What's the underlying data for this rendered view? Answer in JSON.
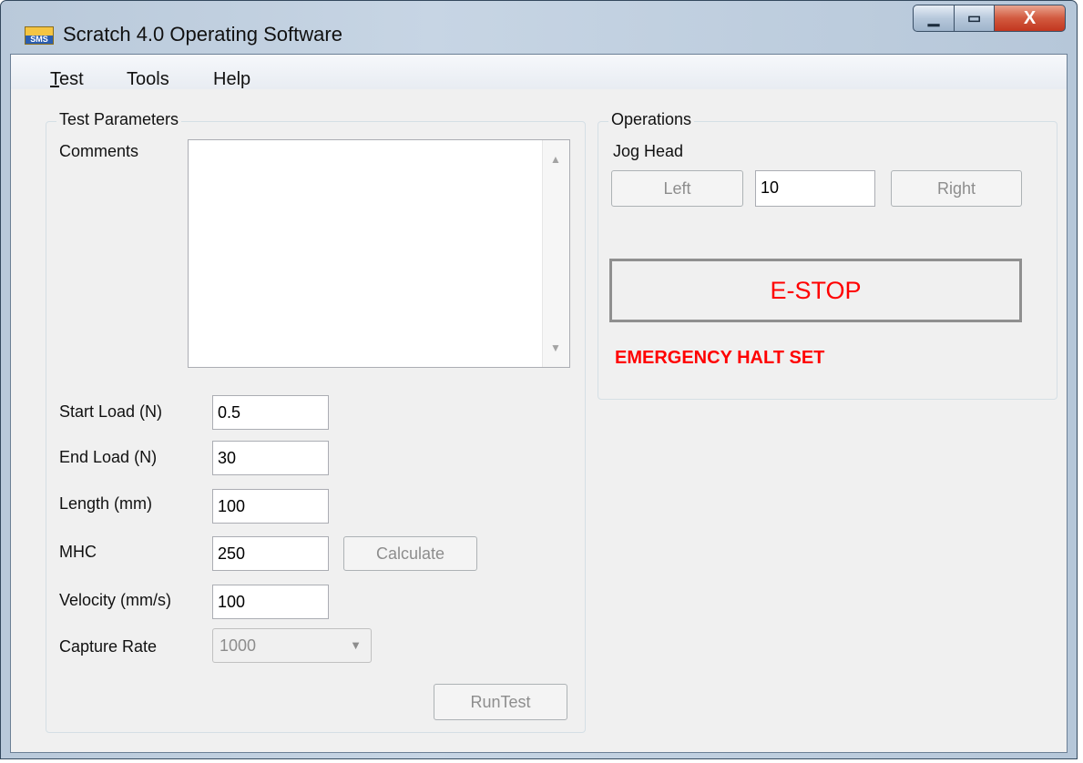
{
  "window": {
    "title": "Scratch 4.0 Operating Software",
    "app_icon_text": "SMS",
    "controls": {
      "minimize": "▁",
      "maximize": "▭",
      "close": "X"
    }
  },
  "menu": [
    {
      "hotkey": "T",
      "rest": "est"
    },
    {
      "hotkey": "",
      "rest": "Tools"
    },
    {
      "hotkey": "",
      "rest": "Help"
    }
  ],
  "test_params": {
    "group_label": "Test Parameters",
    "comments_label": "Comments",
    "comments_value": "",
    "start_load": {
      "label": "Start Load (N)",
      "value": "0.5"
    },
    "end_load": {
      "label": "End Load (N)",
      "value": "30"
    },
    "length": {
      "label": "Length (mm)",
      "value": "100"
    },
    "mhc": {
      "label": "MHC",
      "value": "250"
    },
    "calculate_label": "Calculate",
    "velocity": {
      "label": "Velocity (mm/s)",
      "value": "100"
    },
    "capture_rate": {
      "label": "Capture Rate",
      "value": "1000"
    },
    "run_label": "RunTest"
  },
  "operations": {
    "group_label": "Operations",
    "jog_label": "Jog Head",
    "left_label": "Left",
    "jog_value": "10",
    "right_label": "Right",
    "estop_label": "E-STOP",
    "halt_status": "EMERGENCY HALT SET"
  },
  "colors": {
    "estop_text": "#ff0000",
    "status": "#ff0000"
  }
}
